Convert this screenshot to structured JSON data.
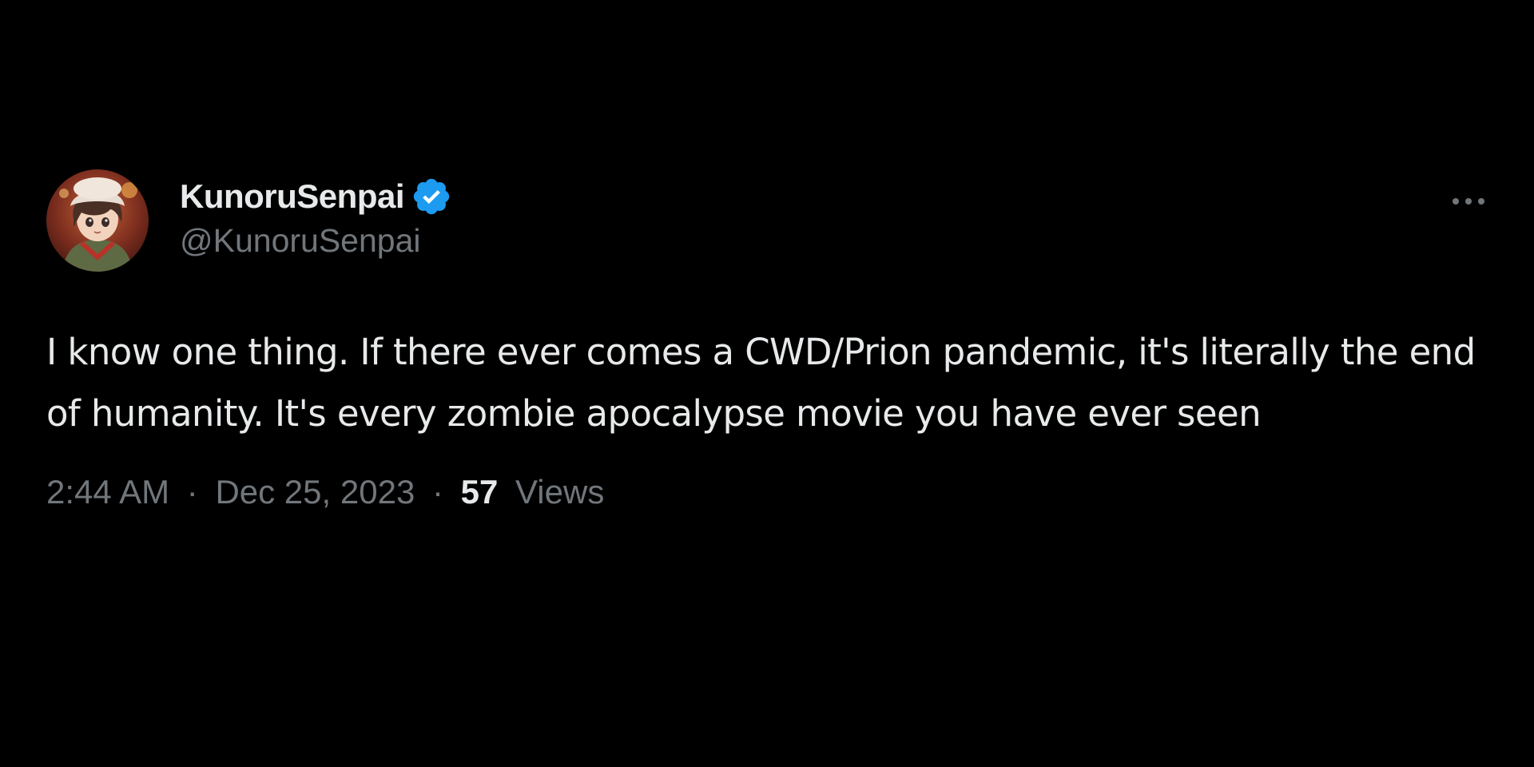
{
  "tweet": {
    "display_name": "KunoruSenpai",
    "handle": "@KunoruSenpai",
    "verified_icon": "verified-badge-icon",
    "more_icon": "more-options-icon",
    "text": "I know one thing. If there ever comes a CWD/Prion pandemic, it's literally the end of humanity. It's every zombie apocalypse movie you have ever seen",
    "time": "2:44 AM",
    "separator": "·",
    "date": "Dec 25, 2023",
    "views_count": "57",
    "views_label": "Views"
  },
  "colors": {
    "background": "#000000",
    "primary_text": "#e7e9ea",
    "secondary_text": "#71767b",
    "verified_blue": "#1d9bf0"
  }
}
